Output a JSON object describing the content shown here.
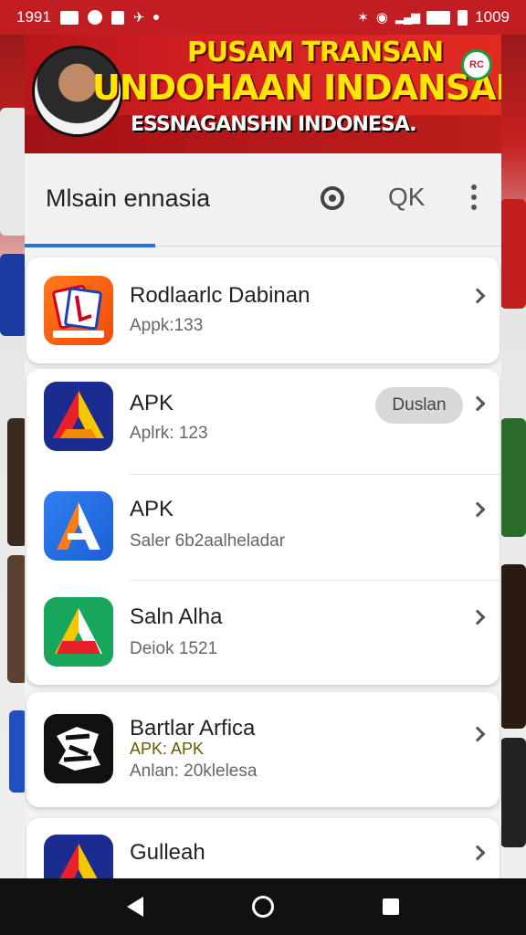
{
  "status_bar": {
    "time": "1991",
    "battery": "1009"
  },
  "banner": {
    "line1": "PUSAM TRANSAN",
    "line2": "UNDOHAAN INDANSAN",
    "line3": "ESSNAGANSHN INDONESA.",
    "badge": "RC"
  },
  "appbar": {
    "title": "Mlsain ennasia",
    "search_label": "QK"
  },
  "items": [
    {
      "title": "Rodlaarlc Dabinan",
      "subtitle": "Appk:133",
      "icon": "stack-cards-icon"
    },
    {
      "title": "APK",
      "subtitle": "Aplrk: 123",
      "button": "Duslan",
      "icon": "arrow-a-icon"
    },
    {
      "title": "APK",
      "subtitle": "Saler 6b2aalheladar",
      "icon": "letter-a-icon"
    },
    {
      "title": "Saln Alha",
      "subtitle": "Deiok 1521",
      "icon": "triangle-a-icon"
    },
    {
      "title": "Bartlar Arfica",
      "accent": "APK: APK",
      "subtitle": "Anlan: 20klelesa",
      "icon": "graffiti-logo-icon"
    },
    {
      "title": "Gulleah",
      "icon": "arrow-a-icon"
    }
  ],
  "colors": {
    "accent_blue": "#2f6fd6",
    "banner_red": "#d31f22",
    "banner_yellow": "#ffe600"
  }
}
